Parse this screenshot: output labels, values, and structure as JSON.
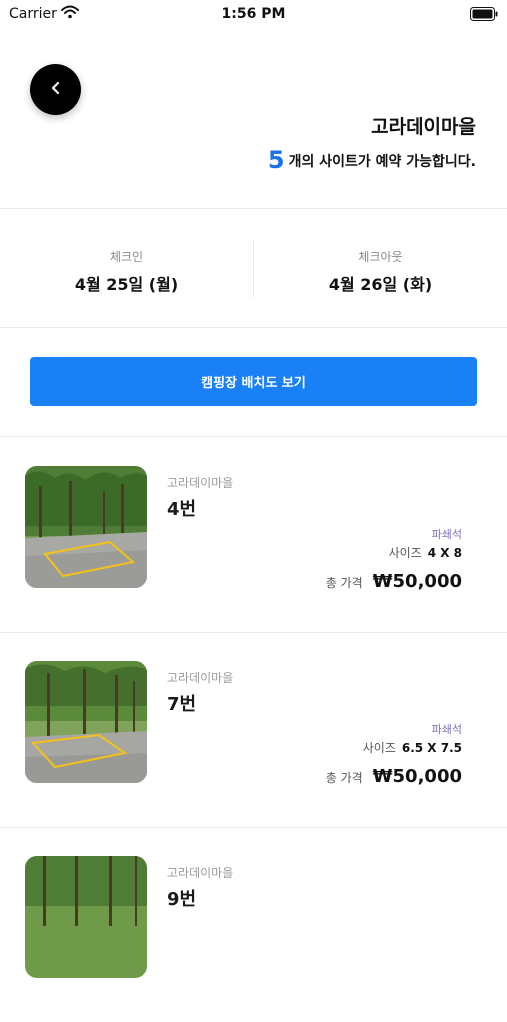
{
  "status": {
    "carrier": "Carrier",
    "time": "1:56 PM"
  },
  "header": {
    "camp_name": "고라데이마을",
    "available_count": "5",
    "available_text": "개의 사이트가 예약 가능합니다."
  },
  "dates": {
    "checkin_label": "체크인",
    "checkin_value": "4월 25일 (월)",
    "checkout_label": "체크아웃",
    "checkout_value": "4월 26일 (화)"
  },
  "map_button_label": "캠핑장 배치도 보기",
  "sites": [
    {
      "camp_name": "고라데이마을",
      "number": "4번",
      "type": "파쇄석",
      "size_label": "사이즈",
      "size_value": "4 X 8",
      "price_label": "총 가격",
      "price_value": "₩50,000"
    },
    {
      "camp_name": "고라데이마을",
      "number": "7번",
      "type": "파쇄석",
      "size_label": "사이즈",
      "size_value": "6.5 X 7.5",
      "price_label": "총 가격",
      "price_value": "₩50,000"
    },
    {
      "camp_name": "고라데이마을",
      "number": "9번"
    }
  ],
  "icons": {
    "back": "chevron-left-icon",
    "wifi": "wifi-icon",
    "battery": "battery-icon"
  },
  "colors": {
    "accent": "#1a80f5",
    "count_blue": "#1a73e8",
    "site_type": "#7c6fb6",
    "back_button": "#000000"
  }
}
